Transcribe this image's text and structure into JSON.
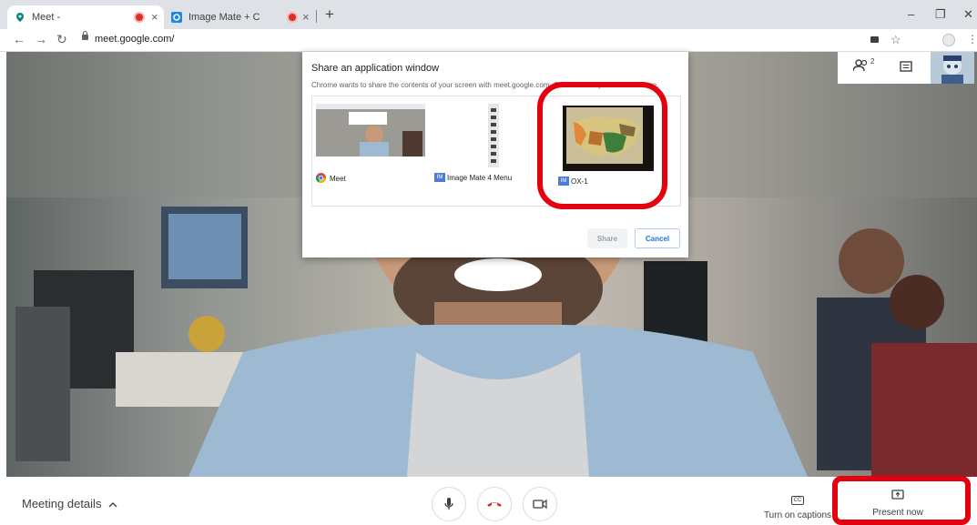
{
  "browser": {
    "tabs": [
      {
        "title": "Meet -",
        "active": true
      },
      {
        "title": "Image Mate + C",
        "active": false
      }
    ],
    "url": "meet.google.com/",
    "new_tab": "+",
    "close": "×",
    "window_controls": {
      "minimize": "–",
      "restore": "❐",
      "close": "✕"
    }
  },
  "dialog": {
    "title": "Share an application window",
    "subtitle": "Chrome wants to share the contents of your screen with meet.google.com. Choose what you'd like to share.",
    "windows": [
      {
        "label": "Meet",
        "icon": "chrome-icon"
      },
      {
        "label": "Image Mate 4 Menu",
        "icon_text": "IM"
      },
      {
        "label": "OX-1",
        "icon_text": "IM"
      }
    ],
    "share_label": "Share",
    "cancel_label": "Cancel"
  },
  "meeting": {
    "participant_count": "2",
    "details_label": "Meeting details",
    "captions_label": "Turn on captions",
    "present_label": "Present now",
    "captions_icon": "CC"
  },
  "colors": {
    "accent": "#1a73e8",
    "hangup": "#d93025",
    "highlight": "#e3000f"
  }
}
